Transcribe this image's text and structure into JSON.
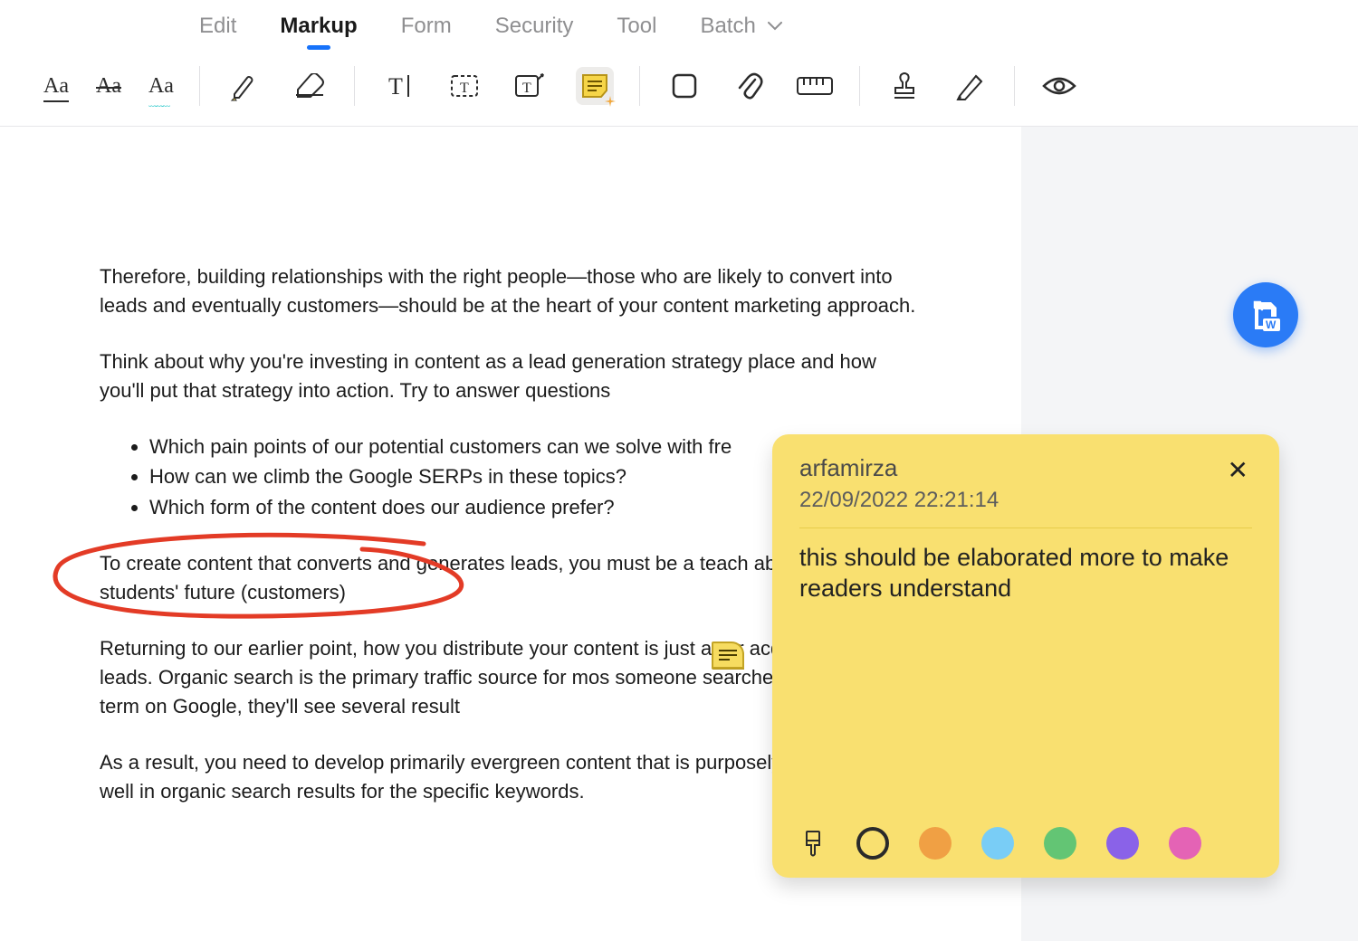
{
  "tabs": {
    "items": [
      {
        "label": "Edit"
      },
      {
        "label": "Markup",
        "active": true
      },
      {
        "label": "Form"
      },
      {
        "label": "Security"
      },
      {
        "label": "Tool"
      },
      {
        "label": "Batch"
      }
    ]
  },
  "toolbar": {
    "underline_label": "Aa",
    "strike_label": "Aa",
    "squiggly_label": "Aa"
  },
  "document": {
    "p1": "Therefore, building relationships with the right people—those who are likely to convert into leads and eventually customers—should be at the heart of your content marketing approach.",
    "p2": "Think about why you're investing in content as a lead generation strategy place and how you'll put that strategy into action. Try to answer questions",
    "li1": "Which pain points of our potential customers can we solve with fre",
    "li2": "How can we climb the Google SERPs in these topics?",
    "li3": "Which form of the content does our audience prefer?",
    "circled": "To create content that converts and generates leads, you must be a teach about your students' future (customers)",
    "p3": "Returning to our earlier point, how you distribute your content is just as cr acquiring more leads. Organic search is the primary traffic source for mos someone searches for a specific term on Google, they'll see several result",
    "p4": "As a result, you need to develop primarily evergreen content that is purposely tailored to rank well in organic search results for the specific keywords."
  },
  "note": {
    "author": "arfamirza",
    "timestamp": "22/09/2022 22:21:14",
    "body": "this should be elaborated more to make readers understand",
    "colors": {
      "orange": "#f0a044",
      "blue": "#79cdf6",
      "green": "#63c574",
      "purple": "#8a62e8",
      "pink": "#e463b5"
    }
  }
}
